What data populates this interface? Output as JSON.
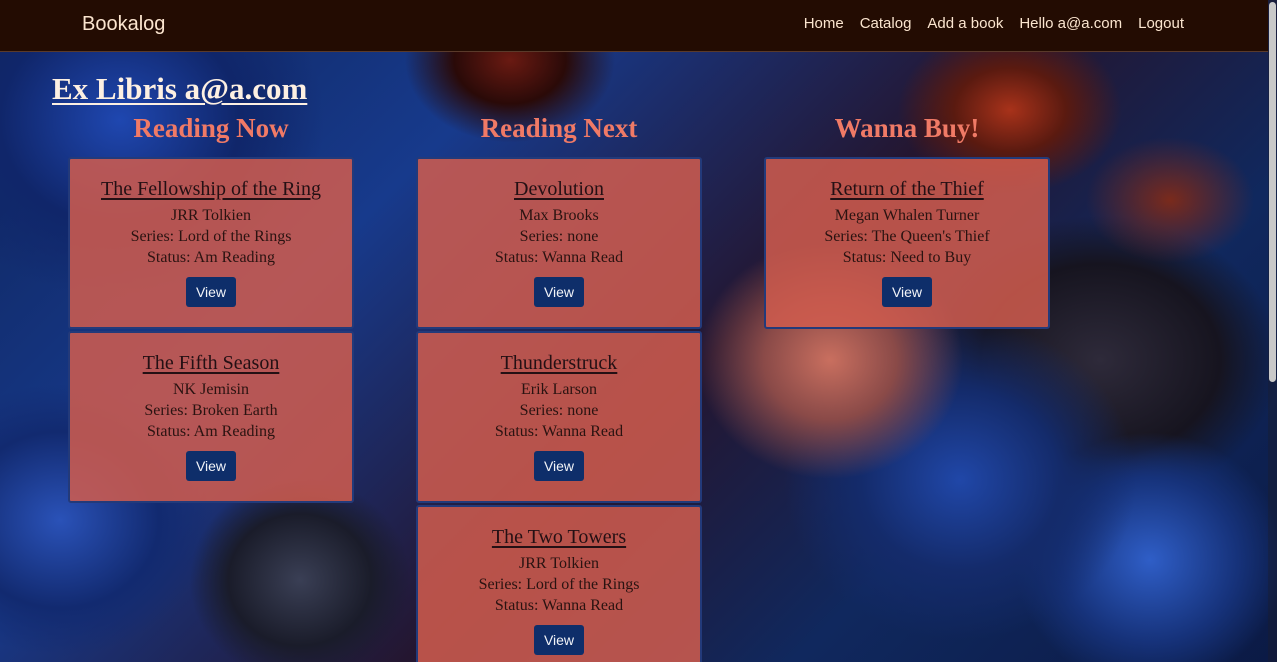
{
  "nav": {
    "brand": "Bookalog",
    "links": [
      "Home",
      "Catalog",
      "Add a book",
      "Hello a@a.com",
      "Logout"
    ]
  },
  "page": {
    "heading": "Ex Libris a@a.com"
  },
  "columns": [
    {
      "title": "Reading Now",
      "books": [
        {
          "title": "The Fellowship of the Ring",
          "author": "JRR Tolkien",
          "series": "Series: Lord of the Rings",
          "status": "Status: Am Reading",
          "button": "View"
        },
        {
          "title": "The Fifth Season",
          "author": "NK Jemisin",
          "series": "Series: Broken Earth",
          "status": "Status: Am Reading",
          "button": "View"
        }
      ]
    },
    {
      "title": "Reading Next",
      "books": [
        {
          "title": "Devolution",
          "author": "Max Brooks",
          "series": "Series: none",
          "status": "Status: Wanna Read",
          "button": "View"
        },
        {
          "title": "Thunderstruck",
          "author": "Erik Larson",
          "series": "Series: none",
          "status": "Status: Wanna Read",
          "button": "View"
        },
        {
          "title": "The Two Towers",
          "author": "JRR Tolkien",
          "series": "Series: Lord of the Rings",
          "status": "Status: Wanna Read",
          "button": "View"
        }
      ]
    },
    {
      "title": "Wanna Buy!",
      "books": [
        {
          "title": "Return of the Thief",
          "author": "Megan Whalen Turner",
          "series": "Series: The Queen's Thief",
          "status": "Status: Need to Buy",
          "button": "View"
        }
      ]
    }
  ]
}
